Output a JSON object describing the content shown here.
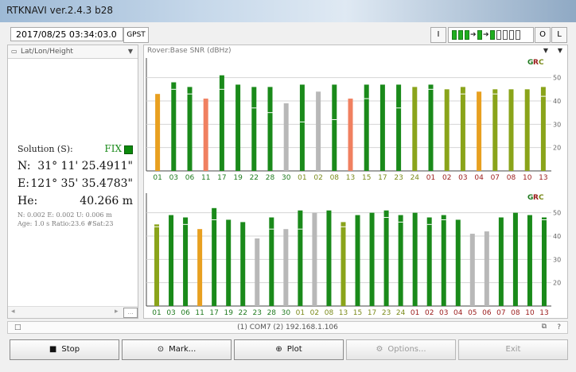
{
  "window": {
    "title": "RTKNAVI ver.2.4.3 b28"
  },
  "toolbar": {
    "time": "2017/08/25 03:34:03.0",
    "time_system": "GPST",
    "info_btn": "I",
    "o_btn": "O",
    "l_btn": "L"
  },
  "left_panel": {
    "header": "Lat/Lon/Height",
    "solution_label": "Solution (S):",
    "solution_status": "FIX",
    "lat_label": "N:",
    "lat_value": "31° 11' 25.4911\"",
    "lon_label": "E:",
    "lon_value": "121° 35' 35.4783\"",
    "height_label": "He:",
    "height_value": "40.266 m",
    "accuracy": "N: 0.002 E: 0.002 U: 0.006 m",
    "age": "Age: 1.0 s Ratio:23.6 #Sat:23",
    "scroll_btn": "..."
  },
  "right_panel": {
    "header": "Rover:Base SNR (dBHz)"
  },
  "status_bar": {
    "text": "(1) COM7 (2) 192.168.1.106",
    "help": "?"
  },
  "buttons": {
    "stop": "Stop",
    "mark": "Mark...",
    "plot": "Plot",
    "options": "Options...",
    "exit": "Exit"
  },
  "colors": {
    "gps": "#1f7a1f",
    "glonass": "#9a1a1a",
    "beidou": "#7a8a1a",
    "bar_green": "#1a8a1a",
    "bar_olive": "#8aa41a",
    "bar_orange": "#e8a020",
    "bar_salmon": "#f08060",
    "bar_gray": "#b8b8b8",
    "fix_green": "#0c8a0c"
  },
  "chart_data": [
    {
      "type": "bar",
      "title": "Rover SNR",
      "legend": [
        "G",
        "R",
        "C"
      ],
      "ylim": [
        10,
        55
      ],
      "yticks": [
        20,
        30,
        40,
        50
      ],
      "categories": [
        "01",
        "03",
        "06",
        "11",
        "17",
        "19",
        "22",
        "28",
        "30",
        "01",
        "02",
        "08",
        "13",
        "15",
        "17",
        "23",
        "24",
        "01",
        "02",
        "03",
        "04",
        "07",
        "08",
        "10",
        "13"
      ],
      "label_systems": [
        "G",
        "G",
        "G",
        "G",
        "G",
        "G",
        "G",
        "G",
        "G",
        "C",
        "C",
        "C",
        "C",
        "C",
        "C",
        "C",
        "C",
        "R",
        "R",
        "R",
        "R",
        "R",
        "R",
        "R",
        "R"
      ],
      "values": [
        43,
        48,
        46,
        41,
        51,
        47,
        46,
        46,
        39,
        47,
        44,
        47,
        41,
        47,
        47,
        47,
        46,
        47,
        45,
        46,
        44,
        45,
        45,
        45,
        46
      ],
      "markers": [
        null,
        45,
        43,
        null,
        45,
        null,
        37,
        35,
        null,
        31,
        null,
        32,
        null,
        41,
        null,
        37,
        null,
        45,
        null,
        43,
        null,
        43,
        null,
        null,
        42
      ],
      "colors": [
        "orange",
        "green",
        "green",
        "salmon",
        "green",
        "green",
        "green",
        "green",
        "gray",
        "green",
        "gray",
        "green",
        "salmon",
        "green",
        "green",
        "green",
        "olive",
        "green",
        "olive",
        "olive",
        "orange",
        "olive",
        "olive",
        "olive",
        "olive"
      ]
    },
    {
      "type": "bar",
      "title": "Base SNR",
      "legend": [
        "G",
        "R",
        "C"
      ],
      "ylim": [
        10,
        55
      ],
      "yticks": [
        20,
        30,
        40,
        50
      ],
      "categories": [
        "01",
        "03",
        "06",
        "11",
        "17",
        "19",
        "22",
        "23",
        "28",
        "30",
        "01",
        "02",
        "08",
        "13",
        "15",
        "17",
        "23",
        "24",
        "01",
        "02",
        "03",
        "04",
        "05",
        "06",
        "07",
        "08",
        "10",
        "13"
      ],
      "label_systems": [
        "G",
        "G",
        "G",
        "G",
        "G",
        "G",
        "G",
        "G",
        "G",
        "G",
        "C",
        "C",
        "C",
        "C",
        "C",
        "C",
        "C",
        "C",
        "R",
        "R",
        "R",
        "R",
        "R",
        "R",
        "R",
        "R",
        "R",
        "R"
      ],
      "values": [
        45,
        49,
        48,
        43,
        52,
        47,
        46,
        39,
        48,
        43,
        51,
        50,
        51,
        46,
        49,
        50,
        51,
        49,
        50,
        48,
        49,
        47,
        41,
        42,
        48,
        50,
        49,
        48
      ],
      "markers": [
        44,
        null,
        45,
        null,
        47,
        null,
        null,
        null,
        43,
        null,
        43,
        null,
        null,
        44,
        null,
        null,
        48,
        46,
        null,
        45,
        47,
        null,
        null,
        null,
        null,
        null,
        null,
        47
      ],
      "colors": [
        "olive",
        "green",
        "green",
        "orange",
        "green",
        "green",
        "green",
        "gray",
        "green",
        "gray",
        "green",
        "gray",
        "green",
        "olive",
        "green",
        "green",
        "green",
        "green",
        "green",
        "green",
        "green",
        "green",
        "gray",
        "gray",
        "green",
        "green",
        "green",
        "green"
      ]
    }
  ]
}
